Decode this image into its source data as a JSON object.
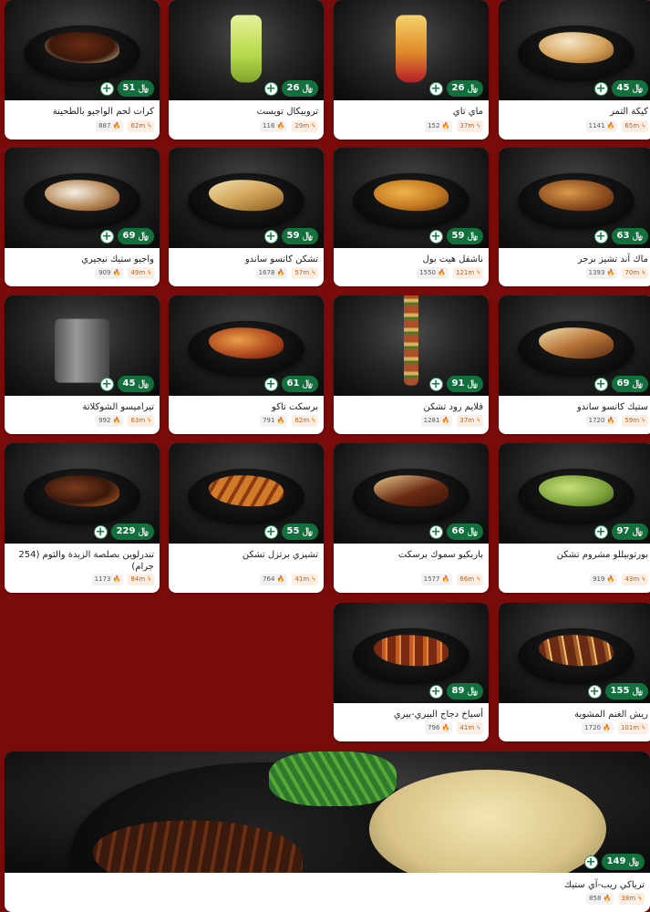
{
  "currency_icon": "riyal-sign-icon",
  "add_icon": "+",
  "cal_icon": "fire-icon",
  "time_icon": "flame-icon",
  "items": [
    {
      "name": "كيكة التمر",
      "price": "45",
      "cal": "1141",
      "time": "65m"
    },
    {
      "name": "ماي تاي",
      "price": "26",
      "cal": "152",
      "time": "37m"
    },
    {
      "name": "تروبيكال تويست",
      "price": "26",
      "cal": "116",
      "time": "29m"
    },
    {
      "name": "كرات لحم الواجيو بالطحينة",
      "price": "51",
      "cal": "887",
      "time": "62m"
    },
    {
      "name": "ماك آند تشيز برجر",
      "price": "63",
      "cal": "1393",
      "time": "70m"
    },
    {
      "name": "ناشفل هيت بول",
      "price": "59",
      "cal": "1550",
      "time": "121m"
    },
    {
      "name": "تشكن كاتسو ساندو",
      "price": "59",
      "cal": "1678",
      "time": "57m"
    },
    {
      "name": "واجيو ستيك نيجيري",
      "price": "69",
      "cal": "909",
      "time": "49m"
    },
    {
      "name": "ستيك كاتسو ساندو",
      "price": "69",
      "cal": "1720",
      "time": "59m"
    },
    {
      "name": "فلايم رود تشكن",
      "price": "91",
      "cal": "1281",
      "time": "37m"
    },
    {
      "name": "برسكت تاكو",
      "price": "61",
      "cal": "791",
      "time": "62m"
    },
    {
      "name": "تيراميسو الشوكلاتة",
      "price": "45",
      "cal": "992",
      "time": "63m"
    },
    {
      "name": "بورتوبيللو مشروم تشكن",
      "price": "97",
      "cal": "919",
      "time": "43m"
    },
    {
      "name": "باربكيو سموك برسكت",
      "price": "66",
      "cal": "1577",
      "time": "66m"
    },
    {
      "name": "تشيزي برتزل تشكن",
      "price": "55",
      "cal": "764",
      "time": "41m"
    },
    {
      "name": "تندرلوين بصلصة الزبدة والثوم (254 جرام)",
      "price": "229",
      "cal": "1173",
      "time": "84m"
    },
    {
      "name": "ريش الغنم المشوية",
      "price": "155",
      "cal": "1720",
      "time": "101m"
    },
    {
      "name": "أسياخ دجاج البيري-بيري",
      "price": "89",
      "cal": "796",
      "time": "41m"
    }
  ],
  "featured": {
    "name": "ترياكي ريب-آي ستيك",
    "price": "149",
    "cal": "858",
    "time": "38m"
  }
}
